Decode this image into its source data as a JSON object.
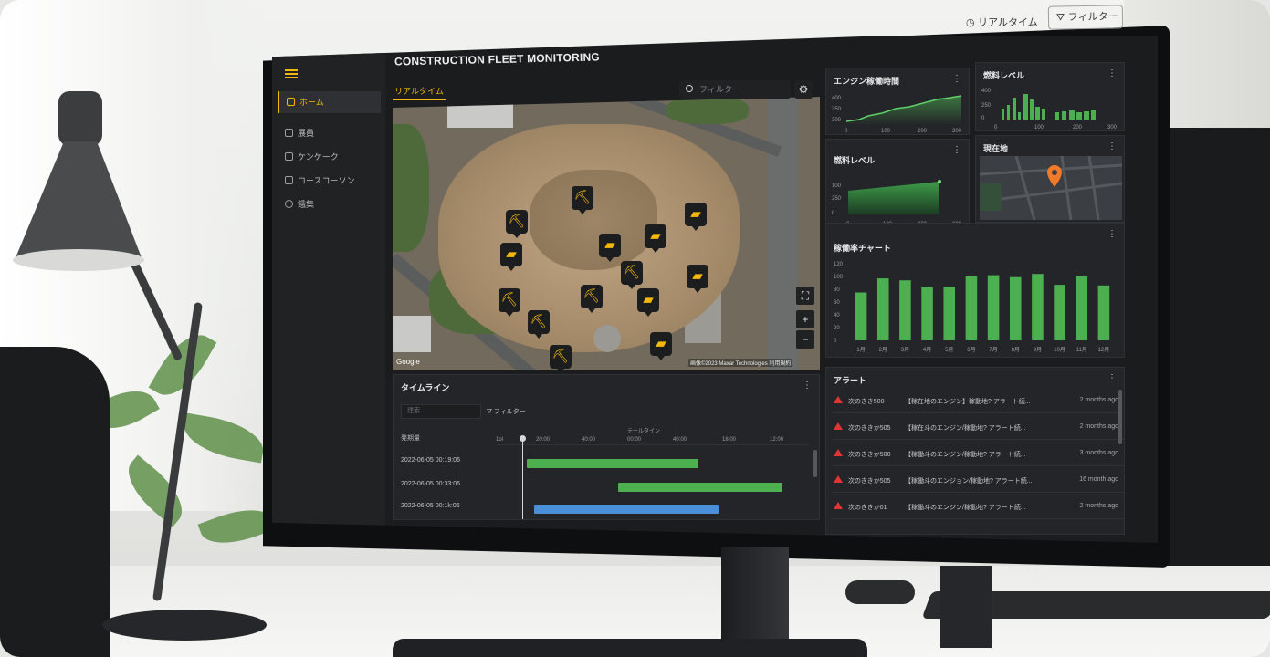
{
  "header": {
    "title": "CONSTRUCTION FLEET MONITORING",
    "realtime_label": "リアルタイム",
    "filter_label": "フィルター"
  },
  "sidebar": {
    "items": [
      {
        "label": "ホーム",
        "icon": "home-icon",
        "active": true
      },
      {
        "label": "展員",
        "icon": "list-icon",
        "active": false
      },
      {
        "label": "ケンケーク",
        "icon": "layers-icon",
        "active": false
      },
      {
        "label": "コースコーソン",
        "icon": "document-icon",
        "active": false
      },
      {
        "label": "餓集",
        "icon": "gear-icon",
        "active": false
      }
    ]
  },
  "tabs": [
    {
      "label": "リアルタイム",
      "active": true
    }
  ],
  "map": {
    "search_placeholder": "フィルター",
    "google_label": "Google",
    "attribution": "画像©2023 Maxar Technologies 利用規約",
    "pins": [
      "excavator",
      "bulldozer",
      "excavator",
      "bulldozer",
      "bulldozer",
      "bulldozer",
      "loader",
      "excavator",
      "loader",
      "excavator",
      "loader",
      "excavator",
      "loader",
      "excavator",
      "bulldozer",
      "loader"
    ]
  },
  "cards": {
    "engine_hours": {
      "title": "エンジン稼働時間",
      "yticks": [
        "400",
        "350",
        "300"
      ],
      "xticks": [
        "0",
        "100",
        "200",
        "300"
      ]
    },
    "fuel_bar": {
      "title": "燃料レベル",
      "yticks": [
        "400",
        "250",
        "0"
      ],
      "xticks": [
        "0",
        "100",
        "200",
        "300"
      ]
    },
    "fuel_area": {
      "title": "燃料レベル",
      "yticks": [
        "100",
        "250",
        "0"
      ],
      "xticks": [
        "0",
        "100",
        "200",
        "300"
      ]
    },
    "location": {
      "title": "現在地"
    },
    "utilization": {
      "title": "稼働率チャート"
    }
  },
  "chart_data": [
    {
      "type": "bar",
      "title": "稼働率チャート",
      "categories": [
        "1月",
        "2月",
        "3月",
        "4月",
        "5月",
        "6月",
        "7月",
        "8月",
        "9月",
        "10月",
        "11月",
        "12月"
      ],
      "values": [
        75,
        97,
        94,
        83,
        84,
        100,
        102,
        99,
        104,
        87,
        100,
        86
      ],
      "ylim": [
        0,
        120
      ],
      "yticks": [
        0,
        20,
        40,
        60,
        80,
        100,
        120
      ],
      "color": "#4caf50"
    }
  ],
  "timeline": {
    "title": "タイムライン",
    "search_placeholder": "建索",
    "filter_label": "フィルター",
    "column_header": "発期量",
    "axis_label": "テールタイン",
    "start_tick": "1ol",
    "ticks": [
      "20:00",
      "40:00",
      "00:00",
      "40:00",
      "18:00",
      "12:00"
    ],
    "rows": [
      {
        "label": "2022-06-05 00:19:06",
        "color": "#4caf50"
      },
      {
        "label": "2022-06-05 00:33:06",
        "color": "#4caf50"
      },
      {
        "label": "2022-06-05 00:1k:06",
        "color": "#4a90d9"
      }
    ]
  },
  "alerts": {
    "title": "アラート",
    "items": [
      {
        "source": "次のきき500",
        "message": "【稼在地のエンジン】稼動地? アラート続...",
        "time": "2 months ago"
      },
      {
        "source": "次のききか505",
        "message": "【稼在斗のエンジン/稼動地? アラート続...",
        "time": "2 months ago"
      },
      {
        "source": "次のききか500",
        "message": "【稼働斗のエンジン/稼動地? アラート続...",
        "time": "3 months ago"
      },
      {
        "source": "次のききか505",
        "message": "【稼働斗のエンジョン/稼動地? アラート続...",
        "time": "16 month ago"
      },
      {
        "source": "次のききか01",
        "message": "【稼働斗のエンジン/稼動地? アラート続...",
        "time": "2 months ago"
      }
    ]
  }
}
